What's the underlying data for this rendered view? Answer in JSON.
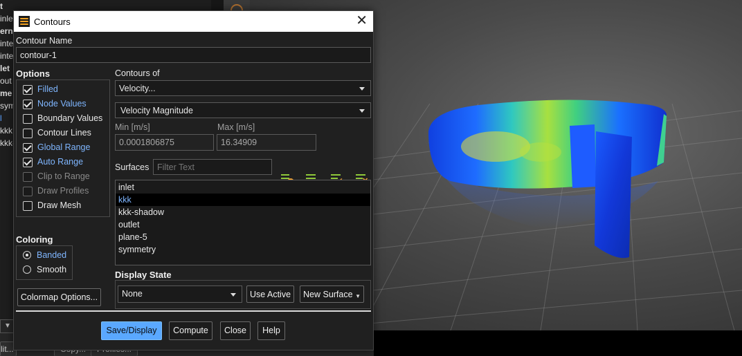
{
  "background": {
    "tree_items": [
      {
        "text": "t",
        "bold": true,
        "selected": false
      },
      {
        "text": "inlet",
        "bold": false,
        "selected": false
      },
      {
        "text": "erna",
        "bold": true,
        "selected": false
      },
      {
        "text": "inte",
        "bold": false,
        "selected": false
      },
      {
        "text": "inte",
        "bold": false,
        "selected": false
      },
      {
        "text": "let",
        "bold": true,
        "selected": false
      },
      {
        "text": "out",
        "bold": false,
        "selected": false
      },
      {
        "text": "me",
        "bold": true,
        "selected": false
      },
      {
        "text": "sym",
        "bold": false,
        "selected": false
      },
      {
        "text": "l",
        "bold": false,
        "selected": true
      },
      {
        "text": "kkk",
        "bold": false,
        "selected": false
      },
      {
        "text": "kkk-",
        "bold": false,
        "selected": false
      }
    ],
    "bottom_buttons": {
      "edit": "lit...",
      "copy": "Copy...",
      "profiles": "Profiles..."
    }
  },
  "dialog": {
    "title": "Contours",
    "contour_name_label": "Contour Name",
    "contour_name_value": "contour-1",
    "options_label": "Options",
    "options": [
      {
        "label": "Filled",
        "checked": true,
        "enabled": true
      },
      {
        "label": "Node Values",
        "checked": true,
        "enabled": true
      },
      {
        "label": "Boundary Values",
        "checked": false,
        "enabled": true
      },
      {
        "label": "Contour Lines",
        "checked": false,
        "enabled": true
      },
      {
        "label": "Global Range",
        "checked": true,
        "enabled": true
      },
      {
        "label": "Auto Range",
        "checked": true,
        "enabled": true
      },
      {
        "label": "Clip to Range",
        "checked": false,
        "enabled": false
      },
      {
        "label": "Draw Profiles",
        "checked": false,
        "enabled": false
      },
      {
        "label": "Draw Mesh",
        "checked": false,
        "enabled": true
      }
    ],
    "coloring_label": "Coloring",
    "coloring": [
      {
        "label": "Banded",
        "selected": true
      },
      {
        "label": "Smooth",
        "selected": false
      }
    ],
    "colormap_button": "Colormap Options...",
    "contours_of_label": "Contours of",
    "contours_of_value": "Velocity...",
    "contours_of_sub_value": "Velocity Magnitude",
    "min_label": "Min [m/s]",
    "min_value": "0.0001806875",
    "max_label": "Max [m/s]",
    "max_value": "16.34909",
    "surfaces_label": "Surfaces",
    "filter_placeholder": "Filter Text",
    "surfaces": [
      {
        "name": "inlet",
        "selected": false
      },
      {
        "name": "kkk",
        "selected": true
      },
      {
        "name": "kkk-shadow",
        "selected": false
      },
      {
        "name": "outlet",
        "selected": false
      },
      {
        "name": "plane-5",
        "selected": false
      },
      {
        "name": "symmetry",
        "selected": false
      }
    ],
    "display_state_label": "Display State",
    "display_state_value": "None",
    "use_active_button": "Use Active",
    "new_surface_button": "New Surface",
    "buttons": {
      "save_display": "Save/Display",
      "compute": "Compute",
      "close": "Close",
      "help": "Help"
    }
  },
  "colors": {
    "accent": "#5aa8ff",
    "checked_text": "#7fb6ff",
    "dialog_bg": "#202020",
    "toolbar_icon_green": "#8fc93a"
  }
}
